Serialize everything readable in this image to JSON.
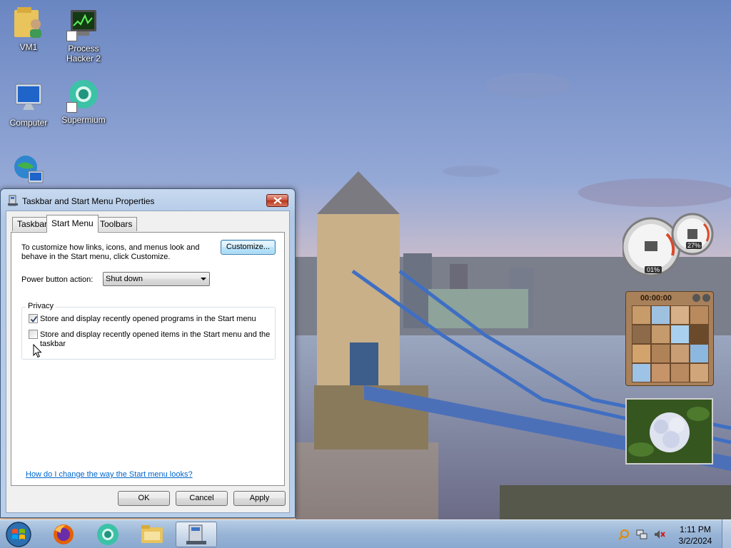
{
  "desktop": {
    "icons": [
      {
        "label": "VM1"
      },
      {
        "label": "Process\nHacker 2"
      },
      {
        "label": "Computer"
      },
      {
        "label": "Supermium"
      },
      {
        "label": ""
      }
    ]
  },
  "window": {
    "title": "Taskbar and Start Menu Properties",
    "tabs": [
      "Taskbar",
      "Start Menu",
      "Toolbars"
    ],
    "active_tab": "Start Menu",
    "description_line1": "To customize how links, icons, and menus look and",
    "description_line2": "behave in the Start menu, click Customize.",
    "customize_label": "Customize...",
    "power_label": "Power button action:",
    "power_value": "Shut down",
    "privacy_label": "Privacy",
    "checkbox1": {
      "label": "Store and display recently opened programs in the Start menu",
      "checked": true
    },
    "checkbox2": {
      "label_line1": "Store and display recently opened items in the Start menu and the",
      "label_line2": "taskbar",
      "checked": false
    },
    "help_link": "How do I change the way the Start menu looks?",
    "ok_label": "OK",
    "cancel_label": "Cancel",
    "apply_label": "Apply"
  },
  "gadgets": {
    "cpu_percent": "01%",
    "memory_percent": "27%",
    "puzzle_timer": "00:00:00"
  },
  "taskbar": {
    "time": "1:11 PM",
    "date": "3/2/2024"
  },
  "colors": {
    "link": "#0066cc",
    "taskbar": "#98b4d6",
    "close_button": "#c9513a"
  }
}
